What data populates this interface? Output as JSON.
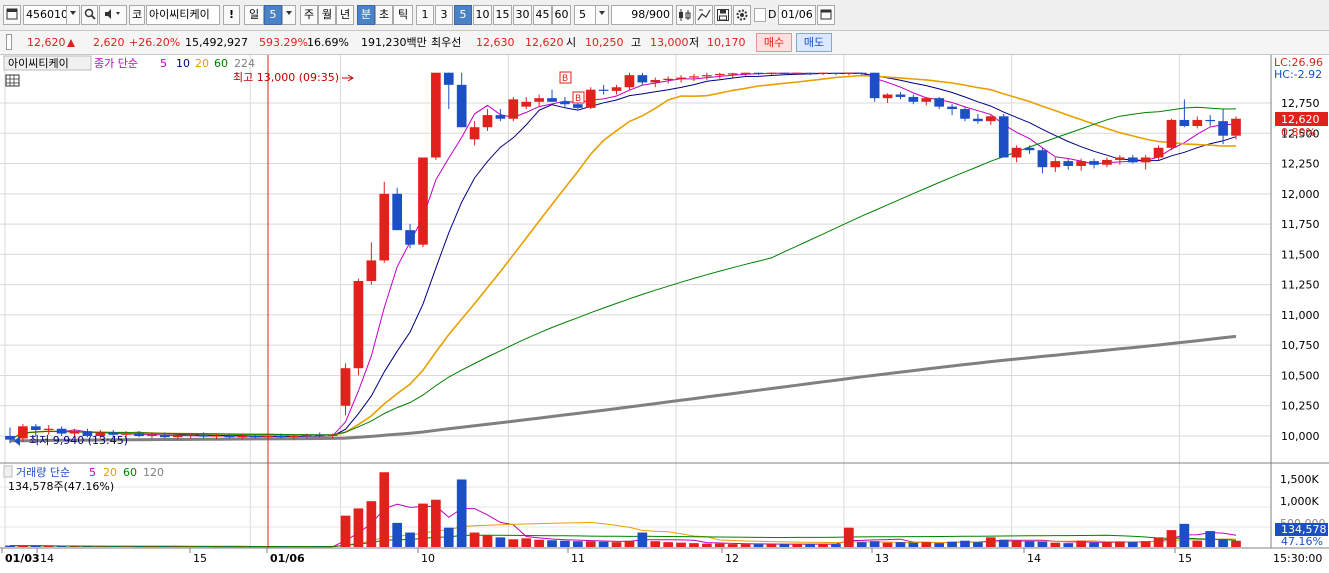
{
  "toolbar": {
    "code": "456010",
    "market_prefix": "코",
    "stock_name": "아이씨티케이",
    "excl_mark": "!",
    "period_day": "일",
    "period_num": "5",
    "period_week": "주",
    "period_month": "월",
    "period_year": "년",
    "period_minute": "분",
    "period_second": "초",
    "period_tick": "틱",
    "intervals": [
      "1",
      "3",
      "5",
      "10",
      "15",
      "30",
      "45",
      "60"
    ],
    "interval_selected": "5",
    "select_value": "5",
    "count_value": "98",
    "count_total": "/900",
    "check_d_label": "D",
    "date_value": "01/06"
  },
  "quote": {
    "price": "12,620",
    "change": "2,620",
    "change_pct": "+26.20%",
    "volume": "15,492,927",
    "volume_ratio": "593.29%",
    "turnover": "16.69%",
    "amount": "191,230백만",
    "bid_label": "최우선",
    "best_ask": "12,630",
    "best_bid": "12,620",
    "open_label": "시",
    "open": "10,250",
    "high_label": "고",
    "high": "13,000",
    "low_label": "저",
    "low": "10,170",
    "buy_label": "매수",
    "sell_label": "매도"
  },
  "price_panel": {
    "stock_label": "아이씨티케이",
    "legend_title": "종가 단순",
    "ma_periods": [
      "5",
      "10",
      "20",
      "60",
      "224"
    ],
    "ma_colors": [
      "#c000c0",
      "#000080",
      "#e8a000",
      "#008000",
      "#808080"
    ],
    "lc": "LC:26.96",
    "hc": "HC:-2.92",
    "high_annot": "최고 13,000 (09:35)",
    "low_annot": "최저 9,940 (13:45)",
    "current_price": "12,620",
    "current_pct": "0.80%",
    "buy_marker": "B",
    "y_labels": [
      "12,750",
      "12,500",
      "12,250",
      "12,000",
      "11,750",
      "11,500",
      "11,250",
      "11,000",
      "10,750",
      "10,500",
      "10,250",
      "10,000"
    ]
  },
  "volume_panel": {
    "legend_title": "거래량 단순",
    "ma_periods": [
      "5",
      "20",
      "60",
      "120"
    ],
    "volume_text": "134,578주(47.16%)",
    "y_labels": [
      "1,500K",
      "1,000K"
    ],
    "current_volume": "134,578",
    "current_pct": "47.16%",
    "partial_label": "500,000"
  },
  "x_axis": {
    "labels": [
      "01/03",
      "14",
      "15",
      "01/06",
      "10",
      "11",
      "12",
      "13",
      "14",
      "15"
    ],
    "time": "15:30:00"
  },
  "chart_data": {
    "type": "candlestick",
    "price_scale": {
      "min": 9900,
      "max": 13100,
      "step": 250
    },
    "candles": [
      {
        "o": 10000,
        "h": 10070,
        "l": 9940,
        "c": 9970
      },
      {
        "o": 9980,
        "h": 10100,
        "l": 9950,
        "c": 10080
      },
      {
        "o": 10080,
        "h": 10100,
        "l": 10000,
        "c": 10050
      },
      {
        "o": 10050,
        "h": 10090,
        "l": 10010,
        "c": 10060
      },
      {
        "o": 10060,
        "h": 10080,
        "l": 10000,
        "c": 10020
      },
      {
        "o": 10020,
        "h": 10060,
        "l": 9990,
        "c": 10040
      },
      {
        "o": 10040,
        "h": 10060,
        "l": 9990,
        "c": 10000
      },
      {
        "o": 10000,
        "h": 10050,
        "l": 9980,
        "c": 10030
      },
      {
        "o": 10030,
        "h": 10050,
        "l": 9990,
        "c": 10010
      },
      {
        "o": 10010,
        "h": 10040,
        "l": 9980,
        "c": 10020
      },
      {
        "o": 10020,
        "h": 10040,
        "l": 9990,
        "c": 10000
      },
      {
        "o": 10000,
        "h": 10030,
        "l": 9980,
        "c": 10010
      },
      {
        "o": 10010,
        "h": 10030,
        "l": 9980,
        "c": 9990
      },
      {
        "o": 9990,
        "h": 10020,
        "l": 9970,
        "c": 10000
      },
      {
        "o": 10000,
        "h": 10020,
        "l": 9980,
        "c": 10010
      },
      {
        "o": 10010,
        "h": 10030,
        "l": 9980,
        "c": 9995
      },
      {
        "o": 9995,
        "h": 10020,
        "l": 9970,
        "c": 10005
      },
      {
        "o": 10005,
        "h": 10020,
        "l": 9980,
        "c": 9990
      },
      {
        "o": 9990,
        "h": 10015,
        "l": 9970,
        "c": 10000
      },
      {
        "o": 10000,
        "h": 10015,
        "l": 9980,
        "c": 9995
      },
      {
        "o": 9995,
        "h": 10010,
        "l": 9970,
        "c": 10000
      },
      {
        "o": 10000,
        "h": 10020,
        "l": 9980,
        "c": 9990
      },
      {
        "o": 9990,
        "h": 10010,
        "l": 9970,
        "c": 10000
      },
      {
        "o": 10000,
        "h": 10020,
        "l": 9980,
        "c": 10010
      },
      {
        "o": 10010,
        "h": 10030,
        "l": 9990,
        "c": 10000
      },
      {
        "o": 10000,
        "h": 10020,
        "l": 9980,
        "c": 10010
      },
      {
        "o": 10250,
        "h": 10600,
        "l": 10170,
        "c": 10560
      },
      {
        "o": 10560,
        "h": 11300,
        "l": 10500,
        "c": 11280
      },
      {
        "o": 11280,
        "h": 11600,
        "l": 11250,
        "c": 11450
      },
      {
        "o": 11450,
        "h": 12100,
        "l": 11430,
        "c": 12000
      },
      {
        "o": 12000,
        "h": 12050,
        "l": 11700,
        "c": 11700
      },
      {
        "o": 11700,
        "h": 11750,
        "l": 11550,
        "c": 11580
      },
      {
        "o": 11580,
        "h": 12300,
        "l": 11560,
        "c": 12300
      },
      {
        "o": 12300,
        "h": 13000,
        "l": 12280,
        "c": 13000
      },
      {
        "o": 13000,
        "h": 13000,
        "l": 12700,
        "c": 12900
      },
      {
        "o": 12900,
        "h": 13000,
        "l": 12550,
        "c": 12550
      },
      {
        "o": 12450,
        "h": 12600,
        "l": 12400,
        "c": 12550
      },
      {
        "o": 12550,
        "h": 12700,
        "l": 12520,
        "c": 12650
      },
      {
        "o": 12650,
        "h": 12700,
        "l": 12600,
        "c": 12620
      },
      {
        "o": 12620,
        "h": 12800,
        "l": 12600,
        "c": 12780
      },
      {
        "o": 12720,
        "h": 12800,
        "l": 12700,
        "c": 12760
      },
      {
        "o": 12760,
        "h": 12820,
        "l": 12720,
        "c": 12790
      },
      {
        "o": 12790,
        "h": 12860,
        "l": 12760,
        "c": 12760
      },
      {
        "o": 12760,
        "h": 12800,
        "l": 12710,
        "c": 12740
      },
      {
        "o": 12740,
        "h": 12780,
        "l": 12700,
        "c": 12710
      },
      {
        "o": 12710,
        "h": 12880,
        "l": 12700,
        "c": 12860
      },
      {
        "o": 12860,
        "h": 12900,
        "l": 12820,
        "c": 12850
      },
      {
        "o": 12850,
        "h": 12900,
        "l": 12820,
        "c": 12880
      },
      {
        "o": 12880,
        "h": 13000,
        "l": 12860,
        "c": 12980
      },
      {
        "o": 12980,
        "h": 13000,
        "l": 12900,
        "c": 12920
      },
      {
        "o": 12920,
        "h": 12960,
        "l": 12880,
        "c": 12940
      },
      {
        "o": 12940,
        "h": 12970,
        "l": 12910,
        "c": 12950
      },
      {
        "o": 12950,
        "h": 12980,
        "l": 12920,
        "c": 12960
      },
      {
        "o": 12960,
        "h": 12990,
        "l": 12930,
        "c": 12970
      },
      {
        "o": 12970,
        "h": 13000,
        "l": 12940,
        "c": 12980
      },
      {
        "o": 12980,
        "h": 13000,
        "l": 12950,
        "c": 12990
      },
      {
        "o": 12990,
        "h": 13000,
        "l": 12960,
        "c": 12995
      },
      {
        "o": 12995,
        "h": 13000,
        "l": 12970,
        "c": 13000
      },
      {
        "o": 13000,
        "h": 13000,
        "l": 12980,
        "c": 12990
      },
      {
        "o": 12990,
        "h": 13000,
        "l": 12980,
        "c": 13000
      },
      {
        "o": 13000,
        "h": 13000,
        "l": 12980,
        "c": 12990
      },
      {
        "o": 12990,
        "h": 13000,
        "l": 12980,
        "c": 13000
      },
      {
        "o": 13000,
        "h": 13000,
        "l": 12980,
        "c": 12990
      },
      {
        "o": 12990,
        "h": 13000,
        "l": 12980,
        "c": 13000
      },
      {
        "o": 13000,
        "h": 13000,
        "l": 12980,
        "c": 12990
      },
      {
        "o": 12990,
        "h": 13000,
        "l": 12980,
        "c": 13000
      },
      {
        "o": 13000,
        "h": 13000,
        "l": 12980,
        "c": 12995
      },
      {
        "o": 13000,
        "h": 13000,
        "l": 12760,
        "c": 12790
      },
      {
        "o": 12790,
        "h": 12830,
        "l": 12750,
        "c": 12820
      },
      {
        "o": 12820,
        "h": 12840,
        "l": 12780,
        "c": 12800
      },
      {
        "o": 12800,
        "h": 12820,
        "l": 12740,
        "c": 12760
      },
      {
        "o": 12760,
        "h": 12800,
        "l": 12730,
        "c": 12790
      },
      {
        "o": 12790,
        "h": 12800,
        "l": 12700,
        "c": 12720
      },
      {
        "o": 12720,
        "h": 12740,
        "l": 12650,
        "c": 12700
      },
      {
        "o": 12700,
        "h": 12720,
        "l": 12600,
        "c": 12620
      },
      {
        "o": 12620,
        "h": 12660,
        "l": 12580,
        "c": 12600
      },
      {
        "o": 12600,
        "h": 12650,
        "l": 12570,
        "c": 12640
      },
      {
        "o": 12640,
        "h": 12660,
        "l": 12300,
        "c": 12300
      },
      {
        "o": 12300,
        "h": 12400,
        "l": 12260,
        "c": 12380
      },
      {
        "o": 12380,
        "h": 12400,
        "l": 12330,
        "c": 12360
      },
      {
        "o": 12360,
        "h": 12380,
        "l": 12170,
        "c": 12220
      },
      {
        "o": 12220,
        "h": 12300,
        "l": 12180,
        "c": 12270
      },
      {
        "o": 12270,
        "h": 12290,
        "l": 12200,
        "c": 12230
      },
      {
        "o": 12230,
        "h": 12290,
        "l": 12190,
        "c": 12270
      },
      {
        "o": 12270,
        "h": 12290,
        "l": 12210,
        "c": 12240
      },
      {
        "o": 12240,
        "h": 12300,
        "l": 12220,
        "c": 12280
      },
      {
        "o": 12280,
        "h": 12320,
        "l": 12240,
        "c": 12300
      },
      {
        "o": 12300,
        "h": 12320,
        "l": 12250,
        "c": 12260
      },
      {
        "o": 12260,
        "h": 12320,
        "l": 12200,
        "c": 12300
      },
      {
        "o": 12300,
        "h": 12400,
        "l": 12280,
        "c": 12380
      },
      {
        "o": 12380,
        "h": 12620,
        "l": 12360,
        "c": 12610
      },
      {
        "o": 12610,
        "h": 12780,
        "l": 12550,
        "c": 12560
      },
      {
        "o": 12560,
        "h": 12640,
        "l": 12540,
        "c": 12610
      },
      {
        "o": 12610,
        "h": 12650,
        "l": 12560,
        "c": 12600
      },
      {
        "o": 12600,
        "h": 12700,
        "l": 12410,
        "c": 12480
      },
      {
        "o": 12480,
        "h": 12640,
        "l": 12450,
        "c": 12620
      }
    ],
    "volume_scale": {
      "min": 0,
      "max": 1700000
    },
    "volume": [
      30000,
      25000,
      20000,
      18000,
      15000,
      12000,
      10000,
      10000,
      9000,
      9000,
      8000,
      8000,
      8000,
      7000,
      7000,
      7000,
      6000,
      6000,
      6000,
      6000,
      5000,
      5000,
      5000,
      5000,
      5000,
      5000,
      650000,
      800000,
      950000,
      1550000,
      500000,
      300000,
      900000,
      980000,
      400000,
      1400000,
      300000,
      250000,
      200000,
      160000,
      180000,
      150000,
      140000,
      130000,
      120000,
      120000,
      110000,
      100000,
      130000,
      300000,
      120000,
      100000,
      90000,
      80000,
      70000,
      70000,
      60000,
      60000,
      60000,
      60000,
      60000,
      60000,
      60000,
      60000,
      60000,
      400000,
      100000,
      120000,
      90000,
      100000,
      90000,
      100000,
      80000,
      110000,
      130000,
      100000,
      200000,
      150000,
      130000,
      120000,
      110000,
      90000,
      80000,
      130000,
      90000,
      100000,
      110000,
      100000,
      120000,
      200000,
      350000,
      480000,
      130000,
      330000,
      150000,
      130000
    ],
    "volume_colors": "candle direction (red up, blue down)"
  }
}
